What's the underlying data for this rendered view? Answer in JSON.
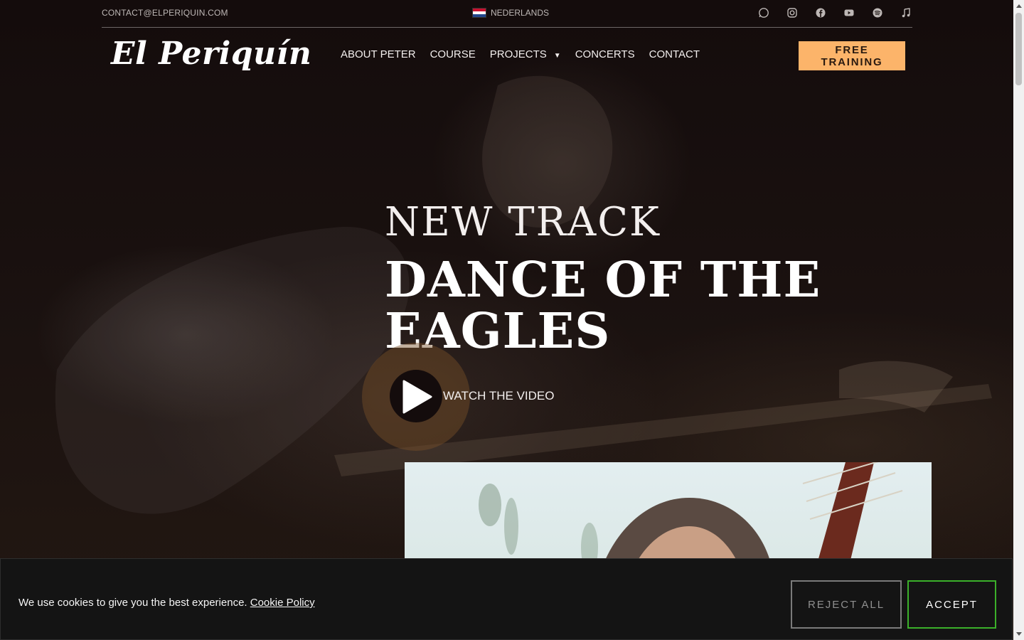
{
  "topbar": {
    "email": "CONTACT@ELPERIQUIN.COM",
    "language": "NEDERLANDS",
    "socials": [
      "whatsapp-icon",
      "instagram-icon",
      "facebook-icon",
      "youtube-icon",
      "spotify-icon",
      "music-icon"
    ]
  },
  "header": {
    "logo": "El Periquín",
    "nav": [
      "ABOUT PETER",
      "COURSE",
      "PROJECTS",
      "CONCERTS",
      "CONTACT"
    ],
    "cta": "FREE TRAINING"
  },
  "hero": {
    "kicker": "NEW TRACK",
    "title": "DANCE OF THE EAGLES",
    "watch": "WATCH THE VIDEO"
  },
  "cookie": {
    "message": "We use cookies to give you the best experience.",
    "policy": "Cookie Policy",
    "reject": "REJECT ALL",
    "accept": "ACCEPT"
  },
  "colors": {
    "accent": "#fcb46a",
    "accept_border": "#3bb02a",
    "background": "#140c0c"
  }
}
